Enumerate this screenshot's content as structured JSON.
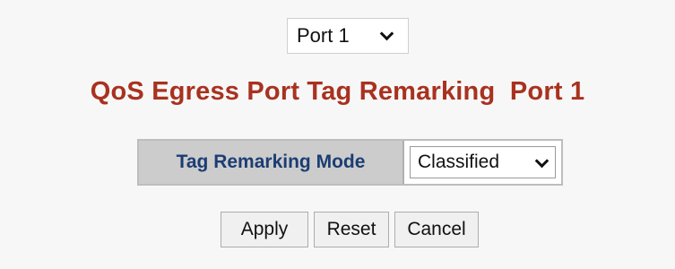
{
  "port_selector": {
    "selected": "Port 1",
    "icon": "chevron-down-icon"
  },
  "page": {
    "title": "QoS Egress Port Tag Remarking  Port 1"
  },
  "config": {
    "tag_remarking_mode_label": "Tag Remarking Mode",
    "tag_remarking_mode_value": "Classified"
  },
  "buttons": {
    "apply": "Apply",
    "reset": "Reset",
    "cancel": "Cancel"
  },
  "colors": {
    "title": "#a8321f",
    "label": "#1c3d73",
    "table_header_bg": "#cccccc",
    "page_bg": "#f7f7f7"
  }
}
